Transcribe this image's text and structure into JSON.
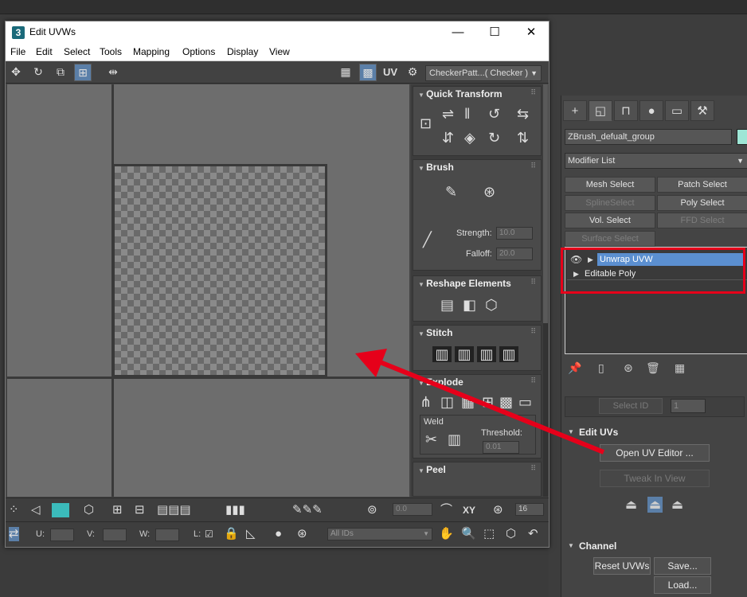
{
  "window": {
    "title": "Edit UVWs",
    "menus": [
      "File",
      "Edit",
      "Select",
      "Tools",
      "Mapping",
      "Options",
      "Display",
      "View"
    ],
    "uv_label": "UV",
    "checker_select": "CheckerPatt...( Checker )"
  },
  "rollouts": {
    "quick_transform": "Quick Transform",
    "brush": "Brush",
    "strength_label": "Strength:",
    "strength_value": "10.0",
    "falloff_label": "Falloff:",
    "falloff_value": "20.0",
    "reshape": "Reshape Elements",
    "stitch": "Stitch",
    "explode": "Explode",
    "weld": "Weld",
    "threshold_label": "Threshold:",
    "threshold_value": "0.01",
    "peel": "Peel"
  },
  "bottom": {
    "spinner_value": "0.0",
    "xy_label": "XY",
    "grid_value": "16",
    "u_label": "U:",
    "v_label": "V:",
    "w_label": "W:",
    "l_label": "L:",
    "ids_select": "All IDs"
  },
  "command_panel": {
    "object_name": "ZBrush_defualt_group",
    "object_color": "#9ee6d6",
    "modifier_list": "Modifier List",
    "buttons": [
      {
        "label": "Mesh Select",
        "enabled": true
      },
      {
        "label": "Patch Select",
        "enabled": true
      },
      {
        "label": "SplineSelect",
        "enabled": false
      },
      {
        "label": "Poly Select",
        "enabled": true
      },
      {
        "label": "Vol. Select",
        "enabled": true
      },
      {
        "label": "FFD Select",
        "enabled": false
      },
      {
        "label": "Surface Select",
        "enabled": false
      }
    ],
    "stack": [
      {
        "label": "Unwrap UVW",
        "selected": true
      },
      {
        "label": "Editable Poly",
        "selected": false
      }
    ],
    "select_id": "Select ID",
    "select_id_value": "1",
    "edit_uvs": "Edit UVs",
    "open_uv_editor": "Open UV Editor ...",
    "tweak_in_view": "Tweak In View",
    "channel": "Channel",
    "reset_uvws": "Reset UVWs",
    "save": "Save...",
    "load": "Load..."
  },
  "annotation_color": "#e6001a"
}
